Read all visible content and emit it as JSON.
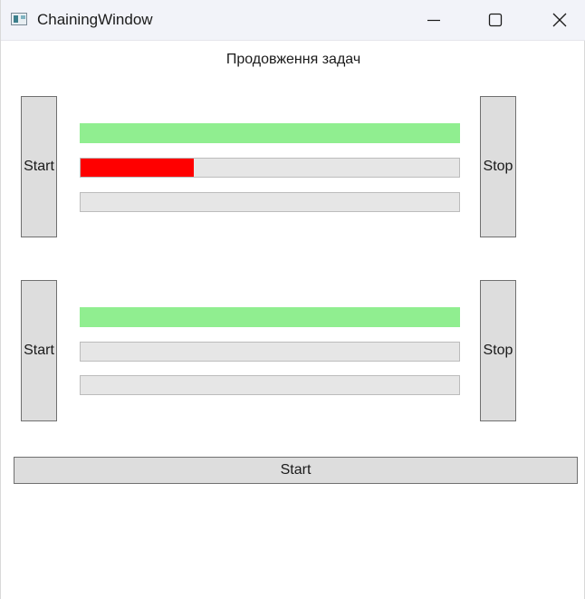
{
  "window": {
    "title": "ChainingWindow"
  },
  "header": {
    "subtitle": "Продовження задач"
  },
  "colors": {
    "done": "#90ee90",
    "error": "#ff0000",
    "track": "#e6e6e6"
  },
  "groups": [
    {
      "start_label": "Start",
      "stop_label": "Stop",
      "bars": [
        {
          "progress": 1.0,
          "color": "#90ee90"
        },
        {
          "progress": 0.3,
          "color": "#ff0000"
        },
        {
          "progress": 0.0,
          "color": "#90ee90"
        }
      ]
    },
    {
      "start_label": "Start",
      "stop_label": "Stop",
      "bars": [
        {
          "progress": 1.0,
          "color": "#90ee90"
        },
        {
          "progress": 0.0,
          "color": "#90ee90"
        },
        {
          "progress": 0.0,
          "color": "#90ee90"
        }
      ]
    }
  ],
  "footer": {
    "start_label": "Start"
  }
}
